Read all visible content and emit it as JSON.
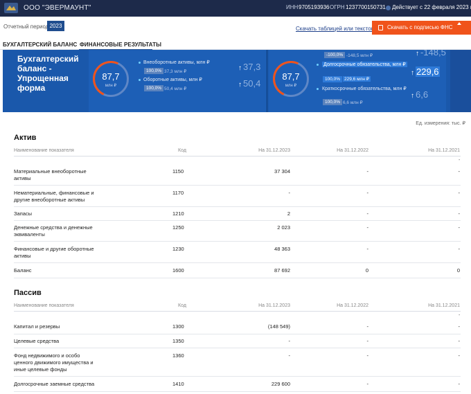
{
  "header": {
    "company": "ООО \"ЭВЕРМАУНТ\"",
    "inn_label": "ИНН",
    "inn": "9705193936",
    "ogrn_label": "ОГРН",
    "ogrn": "1237700150731",
    "status": "Действует с 22 февраля 2023 года"
  },
  "toolbar": {
    "period_label": "Отчетный период:",
    "period_value": "2023",
    "download_text": "Скачать таблицей или текстом",
    "fns_button": "Скачать с подписью ФНС России"
  },
  "tabs": [
    {
      "label": "БУХГАЛТЕРСКИЙ БАЛАНС",
      "active": false
    },
    {
      "label": "ФИНАНСОВЫЕ РЕЗУЛЬТАТЫ",
      "active": true
    }
  ],
  "banner": {
    "title": "Бухгалтерский баланс - Упрощенная форма",
    "assets": {
      "gauge_value": "87,7",
      "gauge_unit": "млн ₽",
      "items": [
        {
          "label": "Внеоборотные активы, млн ₽",
          "pct": "100,0%",
          "value": "37,3 млн ₽",
          "big": "37,3"
        },
        {
          "label": "Оборотные активы, млн ₽",
          "pct": "100,0%",
          "value": "50,4 млн ₽",
          "big": "50,4"
        }
      ]
    },
    "liabilities": {
      "gauge_value": "87,7",
      "gauge_unit": "млн ₽",
      "top_partial": {
        "pct": "-100,0%",
        "value": "-148,5 млн ₽",
        "big": "-148,5"
      },
      "items": [
        {
          "label": "Долгосрочные обязательства, млн ₽",
          "pct": "100,0%",
          "value": "229,6 млн ₽",
          "big": "229,6"
        },
        {
          "label": "Краткосрочные обязательства, млн ₽",
          "pct": "100,0%",
          "value": "6,6 млн ₽",
          "big": "6,6"
        }
      ]
    }
  },
  "units": "Ед. измерения: тыс. ₽",
  "columns": {
    "name": "Наименование показателя",
    "code": "Код",
    "c1": "На 31.12.2023",
    "c2": "На 31.12.2022",
    "c3": "На 31.12.2021"
  },
  "active": {
    "title": "Актив",
    "rows": [
      {
        "name": "Материальные внеоборотные активы",
        "code": "1150",
        "c1": "37 304",
        "c2": "-",
        "c3": "-"
      },
      {
        "name": "Нематериальные, финансовые и другие внеоборотные активы",
        "code": "1170",
        "c1": "-",
        "c2": "-",
        "c3": "-"
      },
      {
        "name": "Запасы",
        "code": "1210",
        "c1": "2",
        "c2": "-",
        "c3": "-"
      },
      {
        "name": "Денежные средства и денежные эквиваленты",
        "code": "1250",
        "c1": "2 023",
        "c2": "-",
        "c3": "-"
      },
      {
        "name": "Финансовые и другие оборотные активы",
        "code": "1230",
        "c1": "48 363",
        "c2": "-",
        "c3": "-"
      },
      {
        "name": "Баланс",
        "code": "1600",
        "c1": "87 692",
        "c2": "0",
        "c3": "0"
      }
    ]
  },
  "passive": {
    "title": "Пассив",
    "rows": [
      {
        "name": "Капитал и резервы",
        "code": "1300",
        "c1": "(148 549)",
        "c2": "-",
        "c3": "-"
      },
      {
        "name": "Целевые средства",
        "code": "1350",
        "c1": "-",
        "c2": "-",
        "c3": "-"
      },
      {
        "name": "Фонд недвижимого и особо ценного движимого имущества и иные целевые фонды",
        "code": "1360",
        "c1": "-",
        "c2": "-",
        "c3": "-"
      },
      {
        "name": "Долгосрочные заемные средства",
        "code": "1410",
        "c1": "229 600",
        "c2": "-",
        "c3": "-"
      }
    ]
  }
}
